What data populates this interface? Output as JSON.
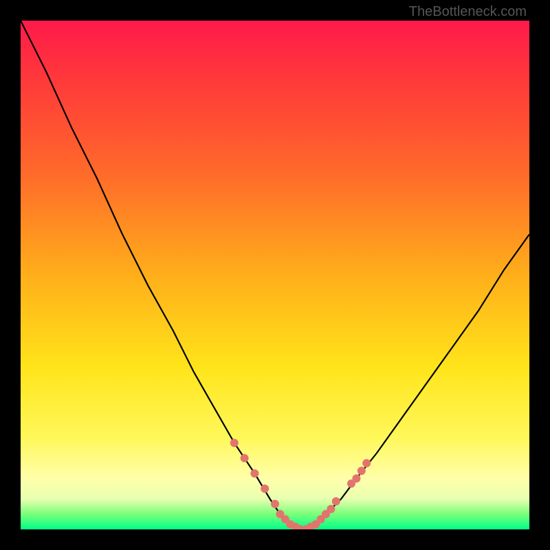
{
  "watermark": "TheBottleneck.com",
  "chart_data": {
    "type": "line",
    "title": "",
    "xlabel": "",
    "ylabel": "",
    "xlim": [
      0,
      100
    ],
    "ylim": [
      0,
      100
    ],
    "series": [
      {
        "name": "bottleneck-curve",
        "x": [
          0,
          5,
          10,
          15,
          20,
          25,
          30,
          34,
          38,
          42,
          46,
          49,
          51,
          53,
          55,
          56,
          58,
          60,
          63,
          66,
          70,
          75,
          80,
          85,
          90,
          95,
          100
        ],
        "y": [
          100,
          90,
          79,
          69,
          58,
          48,
          39,
          31,
          24,
          17,
          11,
          6,
          3,
          1,
          0,
          0,
          1,
          3,
          6,
          10,
          15,
          22,
          29,
          36,
          43,
          51,
          58
        ]
      }
    ],
    "markers": {
      "name": "highlight-dots",
      "color": "#e2746d",
      "x": [
        42,
        44,
        46,
        48,
        50,
        51,
        52,
        53,
        54,
        55,
        56,
        57,
        58,
        59,
        60,
        61,
        62,
        65,
        66,
        67,
        68
      ],
      "y": [
        17,
        14,
        11,
        8,
        5,
        3,
        2,
        1,
        0.5,
        0,
        0,
        0.5,
        1,
        2,
        3,
        4,
        5.5,
        9,
        10,
        11.5,
        13
      ]
    }
  }
}
